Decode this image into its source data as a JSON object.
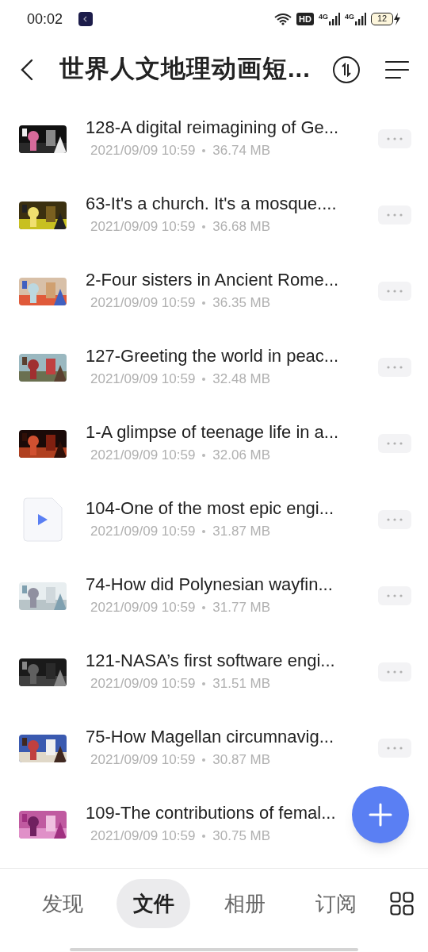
{
  "status_bar": {
    "time": "00:02",
    "hd_badge": "HD",
    "networks": [
      "4G",
      "4G"
    ],
    "battery": "12"
  },
  "header": {
    "title": "世界人文地理动画短..."
  },
  "files": [
    {
      "kind": "video",
      "name": "128-A digital reimagining of Ge...",
      "date": "2021/09/09 10:59",
      "size": "36.74 MB",
      "more": true
    },
    {
      "kind": "video",
      "name": "63-It's a church. It's a mosque....",
      "date": "2021/09/09 10:59",
      "size": "36.68 MB",
      "more": true
    },
    {
      "kind": "video",
      "name": "2-Four sisters in Ancient Rome...",
      "date": "2021/09/09 10:59",
      "size": "36.35 MB",
      "more": true
    },
    {
      "kind": "video",
      "name": "127-Greeting the world in peac...",
      "date": "2021/09/09 10:59",
      "size": "32.48 MB",
      "more": true
    },
    {
      "kind": "video",
      "name": "1-A glimpse of teenage life in a...",
      "date": "2021/09/09 10:59",
      "size": "32.06 MB",
      "more": true
    },
    {
      "kind": "file",
      "name": "104-One of the most epic engi...",
      "date": "2021/09/09 10:59",
      "size": "31.87 MB",
      "more": true
    },
    {
      "kind": "video",
      "name": "74-How did Polynesian wayfin...",
      "date": "2021/09/09 10:59",
      "size": "31.77 MB",
      "more": true
    },
    {
      "kind": "video",
      "name": "121-NASA’s first software engi...",
      "date": "2021/09/09 10:59",
      "size": "31.51 MB",
      "more": true
    },
    {
      "kind": "video",
      "name": "75-How Magellan circumnavig...",
      "date": "2021/09/09 10:59",
      "size": "30.87 MB",
      "more": true
    },
    {
      "kind": "video",
      "name": "109-The contributions of femal...",
      "date": "2021/09/09 10:59",
      "size": "30.75 MB"
    }
  ],
  "tabs": [
    {
      "label": "发现",
      "selected": false
    },
    {
      "label": "文件",
      "selected": true
    },
    {
      "label": "相册",
      "selected": false
    },
    {
      "label": "订阅",
      "selected": false
    }
  ]
}
